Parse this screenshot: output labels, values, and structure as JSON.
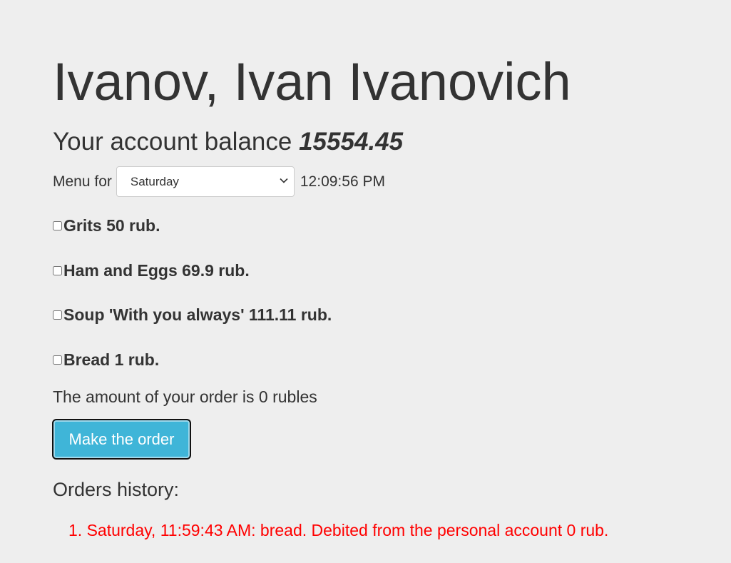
{
  "user": {
    "full_name": "Ivanov, Ivan Ivanovich"
  },
  "balance": {
    "label": "Your account balance",
    "value": "15554.45"
  },
  "menu": {
    "label": "Menu for",
    "selected_day": "Saturday",
    "time": "12:09:56 PM"
  },
  "dishes": [
    {
      "label": "Grits 50 rub.",
      "checked": false
    },
    {
      "label": "Ham and Eggs 69.9 rub.",
      "checked": false
    },
    {
      "label": "Soup 'With you always' 111.11 rub.",
      "checked": false
    },
    {
      "label": "Bread 1 rub.",
      "checked": false
    }
  ],
  "order": {
    "total_text": "The amount of your order is 0 rubles",
    "button_label": "Make the order"
  },
  "history": {
    "title": "Orders history:",
    "entries": [
      "1. Saturday, 11:59:43 AM: bread. Debited from the personal account 0 rub."
    ]
  },
  "colors": {
    "background": "#eeeeee",
    "text": "#333333",
    "button": "#3fb5d8",
    "history_text": "#ff0000"
  }
}
